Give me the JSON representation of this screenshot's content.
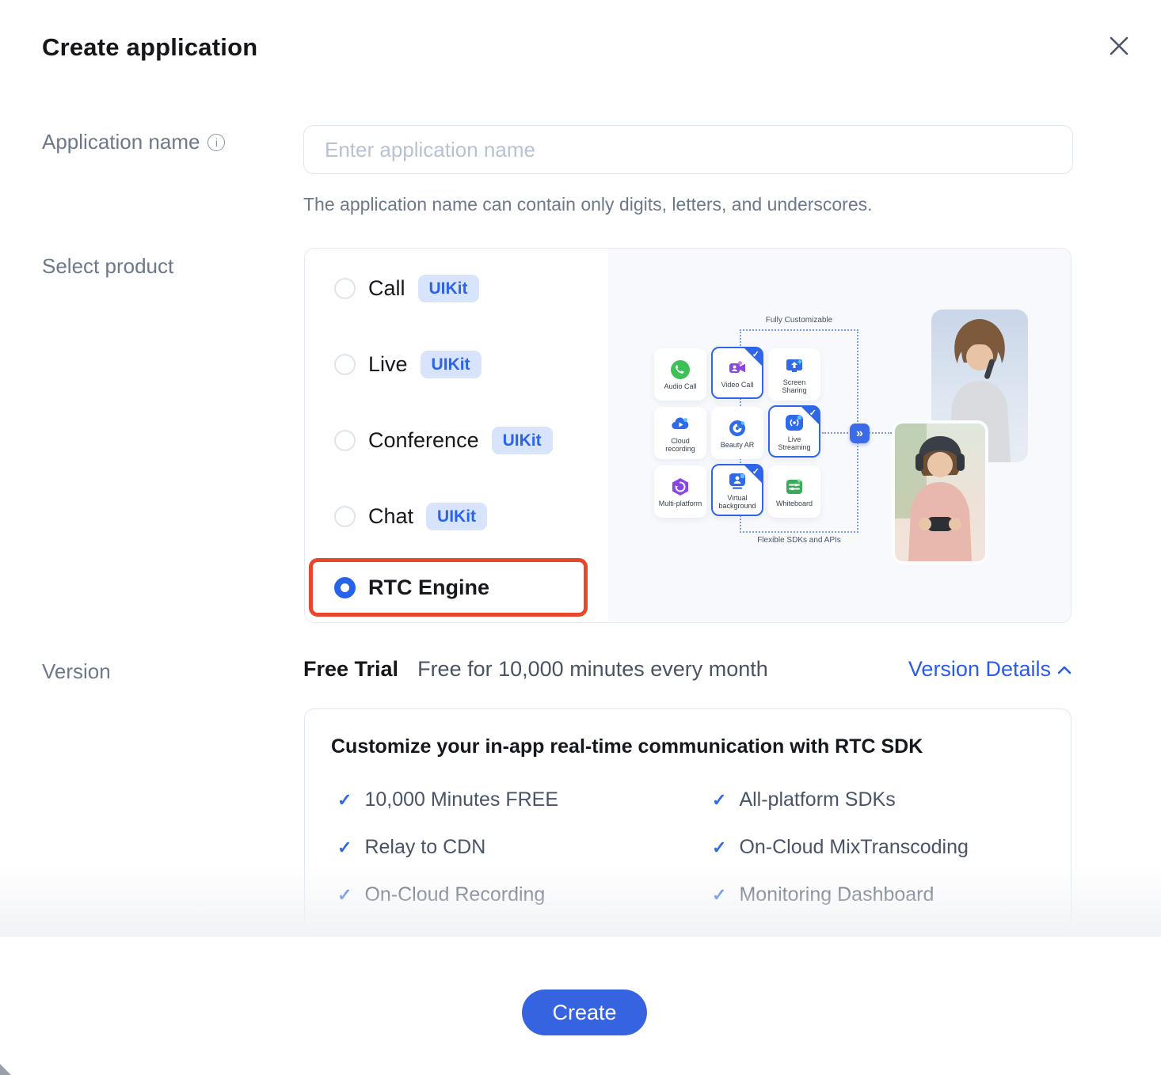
{
  "modal": {
    "title": "Create application"
  },
  "application_name": {
    "label": "Application name",
    "info_icon": "i",
    "placeholder": "Enter application name",
    "value": "",
    "helper": "The application name can contain only digits, letters, and underscores."
  },
  "select_product": {
    "label": "Select product",
    "options": [
      {
        "name": "Call",
        "badge": "UIKit",
        "selected": false
      },
      {
        "name": "Live",
        "badge": "UIKit",
        "selected": false
      },
      {
        "name": "Conference",
        "badge": "UIKit",
        "selected": false
      },
      {
        "name": "Chat",
        "badge": "UIKit",
        "selected": false
      },
      {
        "name": "RTC Engine",
        "badge": "",
        "selected": true,
        "highlighted": true
      }
    ],
    "illustration": {
      "top_caption": "Fully Customizable",
      "bottom_caption": "Flexible SDKs and APIs",
      "arrow_glyph": "»",
      "tiles": [
        {
          "label": "Audio Call",
          "icon": "audio-call-icon",
          "selected": false
        },
        {
          "label": "Video Call",
          "icon": "video-call-icon",
          "selected": true
        },
        {
          "label": "Screen Sharing",
          "icon": "screen-sharing-icon",
          "selected": false
        },
        {
          "label": "Cloud recording",
          "icon": "cloud-recording-icon",
          "selected": false
        },
        {
          "label": "Beauty AR",
          "icon": "beauty-ar-icon",
          "selected": false
        },
        {
          "label": "Live Streaming",
          "icon": "live-streaming-icon",
          "selected": true
        },
        {
          "label": "Multi-platform",
          "icon": "multi-platform-icon",
          "selected": false
        },
        {
          "label": "Virtual background",
          "icon": "virtual-background-icon",
          "selected": true
        },
        {
          "label": "Whiteboard",
          "icon": "whiteboard-icon",
          "selected": false
        }
      ],
      "check_glyph": "✓"
    }
  },
  "version": {
    "label": "Version",
    "tier": "Free Trial",
    "description": "Free for 10,000 minutes every month",
    "details_link": "Version Details",
    "details": {
      "title": "Customize your in-app real-time communication with RTC SDK",
      "check_glyph": "✓",
      "features_left": [
        "10,000 Minutes FREE",
        "Relay to CDN",
        "On-Cloud Recording"
      ],
      "features_right": [
        "All-platform SDKs",
        "On-Cloud MixTranscoding",
        "Monitoring Dashboard"
      ]
    }
  },
  "footer": {
    "create_label": "Create"
  },
  "colors": {
    "accent_blue": "#2c63e8",
    "link_blue": "#2a5ce6",
    "button_blue": "#3663e0",
    "badge_bg": "#d8e4fb",
    "highlight_red": "#e7472d",
    "panel_border": "#e4e9f2",
    "illustration_bg": "#f7f9fc",
    "label_gray": "#6d7889",
    "text_dark": "#14161a"
  }
}
